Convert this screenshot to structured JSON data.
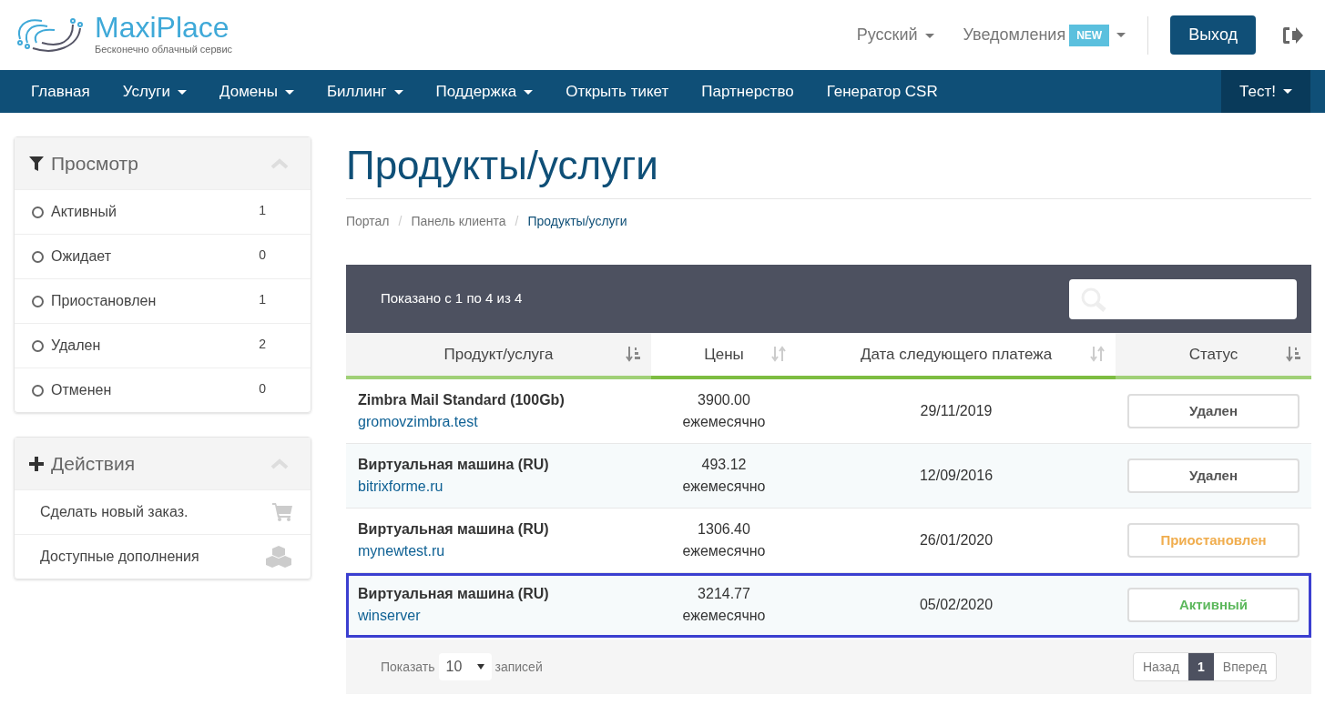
{
  "logo": {
    "name": "MaxiPlace",
    "tagline": "Бесконечно облачный сервис"
  },
  "topbar": {
    "language": "Русский",
    "notifications": "Уведомления",
    "badge": "NEW",
    "logout": "Выход"
  },
  "nav": [
    {
      "label": "Главная",
      "dropdown": false
    },
    {
      "label": "Услуги",
      "dropdown": true
    },
    {
      "label": "Домены",
      "dropdown": true
    },
    {
      "label": "Биллинг",
      "dropdown": true
    },
    {
      "label": "Поддержка",
      "dropdown": true
    },
    {
      "label": "Открыть тикет",
      "dropdown": false
    },
    {
      "label": "Партнерство",
      "dropdown": false
    },
    {
      "label": "Генератор CSR",
      "dropdown": false
    }
  ],
  "account_menu": {
    "label": "Тест!",
    "dropdown": true
  },
  "sidebar": {
    "filter": {
      "title": "Просмотр",
      "items": [
        {
          "label": "Активный",
          "count": "1",
          "selected": false
        },
        {
          "label": "Ожидает",
          "count": "0",
          "selected": false
        },
        {
          "label": "Приостановлен",
          "count": "1",
          "selected": false
        },
        {
          "label": "Удален",
          "count": "2",
          "selected": false
        },
        {
          "label": "Отменен",
          "count": "0",
          "selected": false
        }
      ]
    },
    "actions": {
      "title": "Действия",
      "items": [
        {
          "label": "Сделать новый заказ.",
          "kind": "cart"
        },
        {
          "label": "Доступные дополнения",
          "kind": "cubes"
        }
      ]
    }
  },
  "page_title": "Продукты/услуги",
  "breadcrumb": [
    {
      "label": "Портал",
      "selected": false
    },
    {
      "separator": "/",
      "label": "Панель клиента",
      "selected": false
    },
    {
      "separator": "/",
      "label": "Продукты/услуги",
      "selected": true
    }
  ],
  "table": {
    "info": "Показано с 1 по 4 из 4",
    "columns": [
      {
        "label": "Продукт/услуга",
        "sorted": true
      },
      {
        "label": "Цены",
        "sorted": false
      },
      {
        "label": "Дата следующего платежа",
        "sorted": false
      },
      {
        "label": "Статус",
        "sorted": true
      }
    ],
    "rows": [
      {
        "product": "Zimbra Mail Standard (100Gb)",
        "domain": "gromovzimbra.test",
        "price": "3900.00",
        "cycle": "ежемесячно",
        "date": "29/11/2019",
        "status": "Удален",
        "kind": "deleted",
        "selected": false
      },
      {
        "product": "Виртуальная машина (RU)",
        "domain": "bitrixforme.ru",
        "price": "493.12",
        "cycle": "ежемесячно",
        "date": "12/09/2016",
        "status": "Удален",
        "kind": "deleted",
        "selected": false
      },
      {
        "product": "Виртуальная машина (RU)",
        "domain": "mynewtest.ru",
        "price": "1306.40",
        "cycle": "ежемесячно",
        "date": "26/01/2020",
        "status": "Приостановлен",
        "kind": "suspended",
        "selected": false
      },
      {
        "product": "Виртуальная машина (RU)",
        "domain": "winserver",
        "price": "3214.77",
        "cycle": "ежемесячно",
        "date": "05/02/2020",
        "status": "Активный",
        "kind": "active",
        "selected": true
      }
    ],
    "footer": {
      "show": "Показать",
      "page_size": "10",
      "records": "записей",
      "prev": "Назад",
      "pages": [
        {
          "label": "1",
          "selected": true
        }
      ],
      "next": "Вперед"
    }
  }
}
